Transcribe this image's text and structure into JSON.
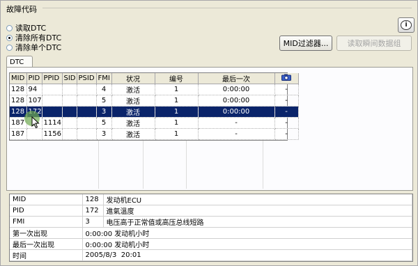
{
  "section_title": "故障代码",
  "radio_options": [
    {
      "label": "读取DTC",
      "selected": false
    },
    {
      "label": "清除所有DTC",
      "selected": true
    },
    {
      "label": "清除单个DTC",
      "selected": false
    }
  ],
  "buttons": {
    "mid_filter": "MID过滤器...",
    "freeze_frame": "读取瞬间数据组"
  },
  "tab_label": "DTC",
  "dtc_table": {
    "headers": [
      "MID",
      "PID",
      "PPID",
      "SID",
      "PSID",
      "FMI",
      "状况",
      "编号",
      "最后一次",
      "camera-icon"
    ],
    "rows": [
      {
        "mid": "128",
        "pid": "94",
        "ppid": "",
        "sid": "",
        "psid": "",
        "fmi": "4",
        "status": "激活",
        "count": "1",
        "last": "0:00:00",
        "extra": "-"
      },
      {
        "mid": "128",
        "pid": "107",
        "ppid": "",
        "sid": "",
        "psid": "",
        "fmi": "5",
        "status": "激活",
        "count": "1",
        "last": "0:00:00",
        "extra": "-"
      },
      {
        "mid": "128",
        "pid": "172",
        "ppid": "",
        "sid": "",
        "psid": "",
        "fmi": "3",
        "status": "激活",
        "count": "1",
        "last": "0:00:00",
        "extra": "-"
      },
      {
        "mid": "187",
        "pid": "",
        "ppid": "1114",
        "sid": "",
        "psid": "",
        "fmi": "5",
        "status": "激活",
        "count": "1",
        "last": "-",
        "extra": "-"
      },
      {
        "mid": "187",
        "pid": "",
        "ppid": "1156",
        "sid": "",
        "psid": "",
        "fmi": "3",
        "status": "激活",
        "count": "1",
        "last": "-",
        "extra": "-"
      }
    ],
    "selected_row": 2
  },
  "details": [
    {
      "label": "MID",
      "value": "128",
      "desc": "发动机ECU"
    },
    {
      "label": "PID",
      "value": "172",
      "desc": "進氣溫度"
    },
    {
      "label": "FMI",
      "value": "3",
      "desc": "电压高于正常值或高压总线短路"
    },
    {
      "label": "第一次出现",
      "value": "0:00:00",
      "desc": "发动机小时"
    },
    {
      "label": "最后一次出现",
      "value": "0:00:00",
      "desc": "发动机小时"
    },
    {
      "label": "时间",
      "value": "2005/8/3",
      "desc": "20:01"
    }
  ]
}
